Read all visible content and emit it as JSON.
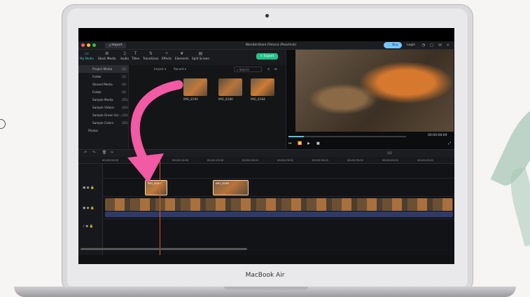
{
  "window": {
    "title": "Wondershare Filmora (Peachick)",
    "import_tab": "Import",
    "buy": "Buy",
    "login": "Login"
  },
  "toolbar": {
    "tabs": [
      {
        "label": "My Media",
        "icon": "folder-icon"
      },
      {
        "label": "Stock Media",
        "icon": "stock-media-icon"
      },
      {
        "label": "Audio",
        "icon": "music-note-icon"
      },
      {
        "label": "Titles",
        "icon": "titles-icon"
      },
      {
        "label": "Transitions",
        "icon": "transitions-icon"
      },
      {
        "label": "Effects",
        "icon": "effects-icon"
      },
      {
        "label": "Elements",
        "icon": "elements-icon"
      },
      {
        "label": "Split Screen",
        "icon": "split-screen-icon"
      }
    ],
    "export_label": "Export"
  },
  "sidebar": {
    "items": [
      {
        "label": "Project Media",
        "count": "(3)"
      },
      {
        "label": "Folder",
        "count": "(3)"
      },
      {
        "label": "Shared Media",
        "count": "(0)"
      },
      {
        "label": "Folder",
        "count": "(0)"
      },
      {
        "label": "Sample Media",
        "count": "(55)"
      },
      {
        "label": "Sample Videos",
        "count": "(20)"
      },
      {
        "label": "Sample Green Scr...",
        "count": "(10)"
      },
      {
        "label": "Sample Colors",
        "count": "(25)"
      },
      {
        "label": "Photos",
        "count": ""
      }
    ]
  },
  "media": {
    "import_menu": "Import",
    "record_menu": "Record",
    "search_placeholder": "Search",
    "import_media_label": "Import Media",
    "items": [
      {
        "name": "IMG_8190"
      },
      {
        "name": "IMG_8180"
      },
      {
        "name": "IMG_8184"
      }
    ]
  },
  "preview": {
    "timecode": "00:00:08:09"
  },
  "timeline": {
    "ruler": [
      "00:00:00:00",
      "00:00:05:00",
      "00:00:10:00",
      "00:00:15:00",
      "00:00:20:01",
      "00:00:25:01",
      "00:00:30:01",
      "00:00:35:01",
      "00:00:40:01",
      "00:00:45:01"
    ],
    "zoom": "1/2",
    "clip_label": "IMG_8180"
  },
  "device": {
    "brand": "MacBook Air"
  },
  "colors": {
    "accent": "#4fc3e0",
    "export": "#22c28a",
    "buy": "#79c7ff",
    "arrow": "#f25aa4",
    "playhead": "#e0552e"
  }
}
